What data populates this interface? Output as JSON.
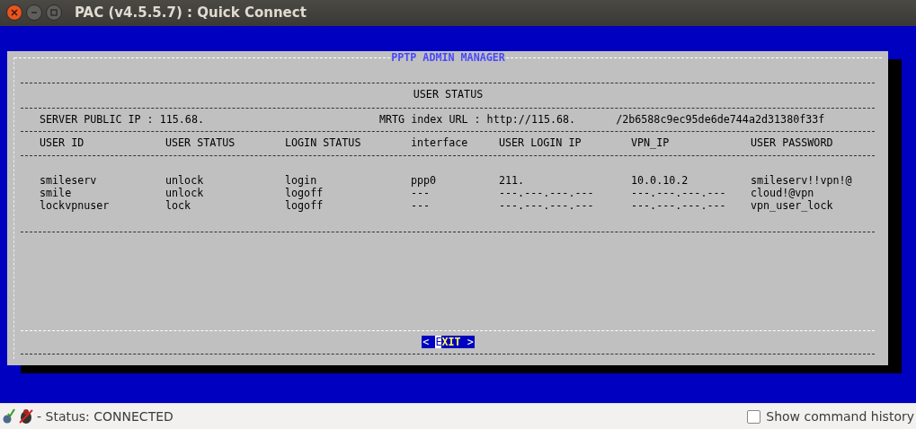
{
  "window": {
    "title": "PAC (v4.5.5.7) : Quick Connect"
  },
  "dialog": {
    "title": "PPTP ADMIN MANAGER",
    "heading": "USER STATUS",
    "server_ip": "SERVER PUBLIC IP : 115.68.",
    "mrtg_label": "MRTG index URL : http://115.68.",
    "mrtg_path": "/2b6588c9ec95de6de744a2d31380f33f",
    "columns": [
      "USER ID",
      "USER STATUS",
      "LOGIN STATUS",
      "interface",
      "USER LOGIN IP",
      "VPN_IP",
      "USER PASSWORD"
    ],
    "rows": [
      [
        "smileserv",
        "unlock",
        "login",
        "ppp0",
        "211.",
        "10.0.10.2",
        "smileserv!!vpn!@"
      ],
      [
        "smile",
        "unlock",
        "logoff",
        "---",
        "---.---.---.---",
        "---.---.---.---",
        "cloud!@vpn"
      ],
      [
        "lockvpnuser",
        "lock",
        "logoff",
        "---",
        "---.---.---.---",
        "---.---.---.---",
        "vpn_user_lock"
      ]
    ],
    "exit_button": {
      "open": "<",
      "hotkey": "E",
      "rest": "XIT",
      "close": ">",
      "focused": true
    }
  },
  "status_bar": {
    "status": "- Status: CONNECTED",
    "history_checkbox": {
      "label": "Show command history",
      "checked": false
    }
  }
}
